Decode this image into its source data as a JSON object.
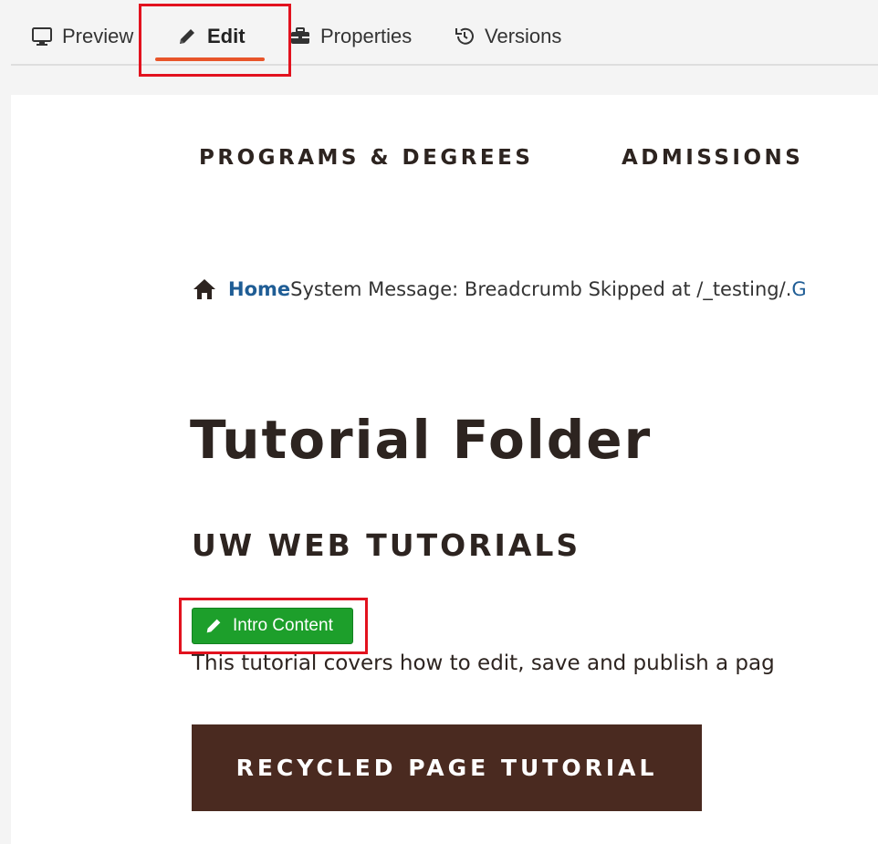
{
  "toolbar": {
    "tabs": [
      {
        "label": "Preview",
        "icon": "monitor-icon"
      },
      {
        "label": "Edit",
        "icon": "pencil-icon",
        "active": true
      },
      {
        "label": "Properties",
        "icon": "toolbox-icon"
      },
      {
        "label": "Versions",
        "icon": "history-icon"
      }
    ],
    "active_underline_color": "#e8552a",
    "highlight_color": "#e2121e"
  },
  "site_nav": {
    "items": [
      "PROGRAMS & DEGREES",
      "ADMISSIONS"
    ]
  },
  "breadcrumb": {
    "home_label": "Home",
    "message": "System Message: Breadcrumb Skipped at /_testing/.",
    "truncated_link": "G"
  },
  "page": {
    "title": "Tutorial Folder",
    "subtitle": "UW WEB TUTORIALS",
    "intro_button_label": "Intro Content",
    "intro_text": "This tutorial covers how to edit, save and publish a pag",
    "cta_label": "RECYCLED PAGE TUTORIAL",
    "cta_color": "#4a2a20",
    "intro_button_color": "#1d9f2b"
  }
}
